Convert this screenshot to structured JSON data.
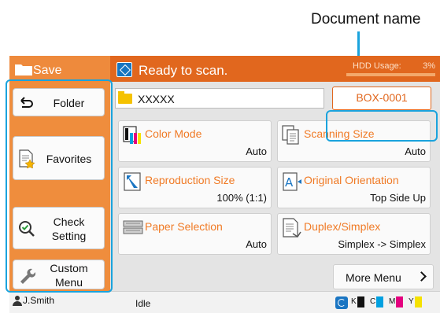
{
  "callout": {
    "document_name_label": "Document name"
  },
  "header": {
    "save_label": "Save",
    "status_text": "Ready to scan.",
    "hdd_label": "HDD Usage:",
    "hdd_value": "3%",
    "hdd_usage_fraction": 0.03
  },
  "sidebar": {
    "folder_label": "Folder",
    "favorites_label": "Favorites",
    "check_setting_label": "Check Setting",
    "custom_menu_label": "Custom Menu"
  },
  "document": {
    "name": "XXXXX",
    "box_button": "BOX-0001"
  },
  "tiles": {
    "color_mode": {
      "title": "Color Mode",
      "value": "Auto"
    },
    "scanning_size": {
      "title": "Scanning Size",
      "value": "Auto"
    },
    "reproduction_size": {
      "title": "Reproduction Size",
      "value": "100% (1:1)"
    },
    "original_orientation": {
      "title": "Original Orientation",
      "value": "Top Side Up"
    },
    "paper_selection": {
      "title": "Paper Selection",
      "value": "Auto"
    },
    "duplex_simplex": {
      "title": "Duplex/Simplex",
      "value": "Simplex -> Simplex"
    }
  },
  "more_menu_label": "More Menu",
  "statusbar": {
    "user": "J.Smith",
    "state": "Idle",
    "ink": {
      "k": "K",
      "c": "C",
      "m": "M",
      "y": "Y"
    }
  },
  "colors": {
    "accent_orange": "#e1671e",
    "sidebar_orange": "#ef8d3d",
    "callout_blue": "#1aa3dd",
    "ink_cyan": "#00a0e0",
    "ink_magenta": "#e4007f",
    "ink_yellow": "#f5e100"
  }
}
